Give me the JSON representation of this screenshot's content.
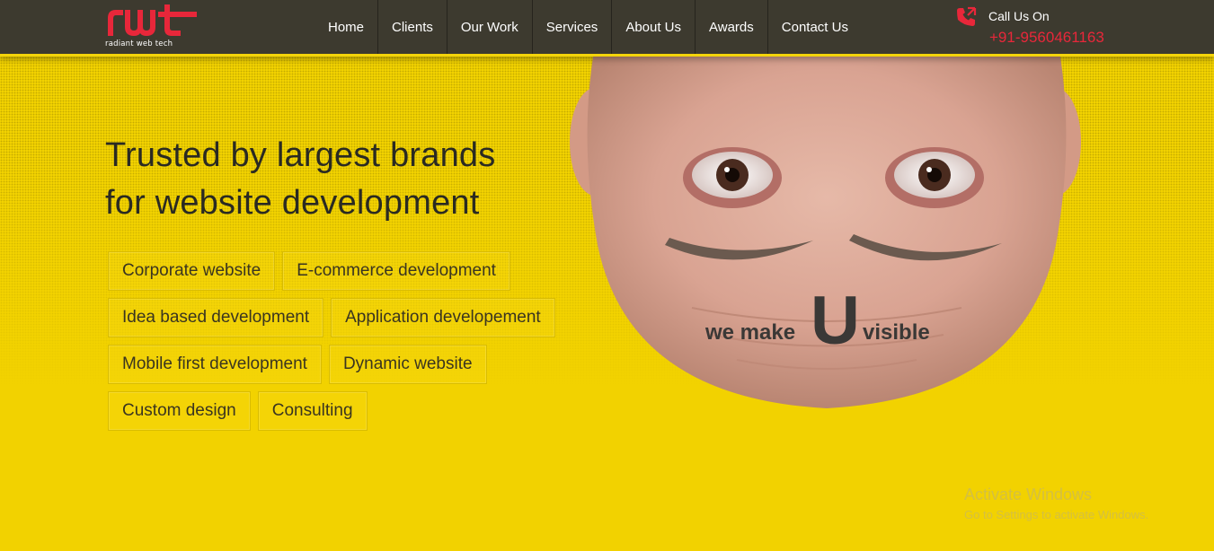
{
  "brand": {
    "logo_text": "rwt",
    "tagline": "radiant web tech",
    "color": "#e8273a"
  },
  "nav": {
    "items": [
      "Home",
      "Clients",
      "Our Work",
      "Services",
      "About Us",
      "Awards",
      "Contact Us"
    ]
  },
  "contact": {
    "label": "Call Us On",
    "number": "+91-9560461163",
    "icon": "phone-call-icon"
  },
  "hero": {
    "headline_line1": "Trusted by largest brands",
    "headline_line2": "for website development",
    "slogan_before": "we make",
    "slogan_letter": "U",
    "slogan_after": "visible",
    "tags": [
      [
        "Corporate website",
        "E-commerce development"
      ],
      [
        "Idea based development",
        "Application developement"
      ],
      [
        "Mobile first development",
        "Dynamic website"
      ],
      [
        "Custom design",
        "Consulting"
      ]
    ],
    "background_color": "#f2d200"
  },
  "watermark": {
    "title": "Activate Windows",
    "subtitle": "Go to Settings to activate Windows."
  }
}
